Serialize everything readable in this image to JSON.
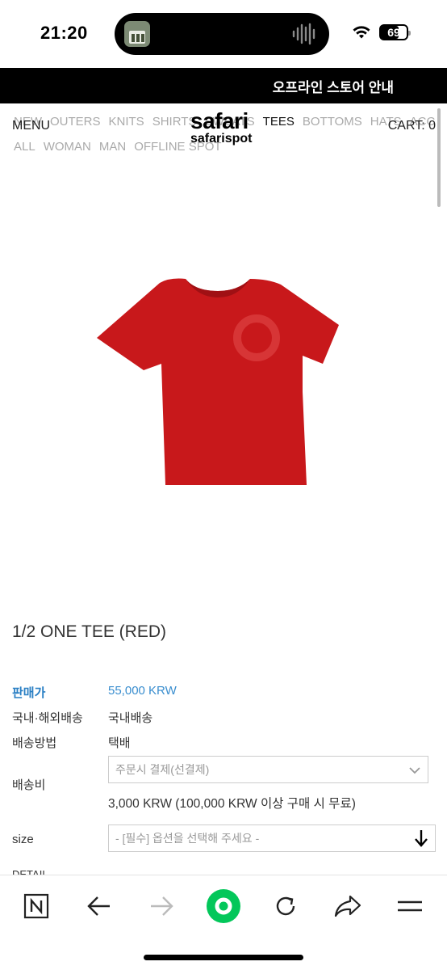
{
  "status_bar": {
    "time": "21:20",
    "battery": "69",
    "battery_level": 0.69,
    "icons": [
      "app-thumbnail-icon",
      "audio-waveform-icon",
      "wifi-icon",
      "battery-icon"
    ]
  },
  "notice": {
    "text": "오프라인 스토어 안내"
  },
  "header": {
    "menu_label": "MENU",
    "cart_label": "CART: 0",
    "logo_main": "safari",
    "logo_sub": "safarispot",
    "nav_row1": [
      "NEW",
      "OUTERS",
      "KNITS",
      "SHIRTS",
      "SWEATS",
      "TEES",
      "BOTTOMS",
      "HATS",
      "ACC"
    ],
    "nav_row2": [
      "ALL",
      "WOMAN",
      "MAN",
      "OFFLINE SPOT"
    ],
    "active_category": "TEES"
  },
  "product": {
    "title": "1/2 ONE TEE (RED)",
    "image_icon": "red-t-shirt-image",
    "shirt_color": "#c8181b",
    "price_label": "판매가",
    "price_value": "55,000 KRW",
    "shipping_region_label": "국내·해외배송",
    "shipping_region_value": "국내배송",
    "shipping_method_label": "배송방법",
    "shipping_method_value": "택배",
    "shipping_fee_label": "배송비",
    "shipping_fee_select": "주문시 결제(선결제)",
    "shipping_fee_note": "3,000 KRW (100,000 KRW 이상 구매 시 무료)",
    "size_label": "size",
    "size_placeholder": "- [필수] 옵션을 선택해 주세요 -",
    "detail_label": "DETAIL"
  },
  "colors": {
    "price_accent": "#3a8ecf",
    "browser_accent": "#03c75a"
  },
  "toolbar": {
    "items": [
      "naver-home-icon",
      "back-arrow-icon",
      "forward-arrow-icon",
      "naver-green-dot-icon",
      "reload-icon",
      "share-icon",
      "menu-icon"
    ]
  }
}
